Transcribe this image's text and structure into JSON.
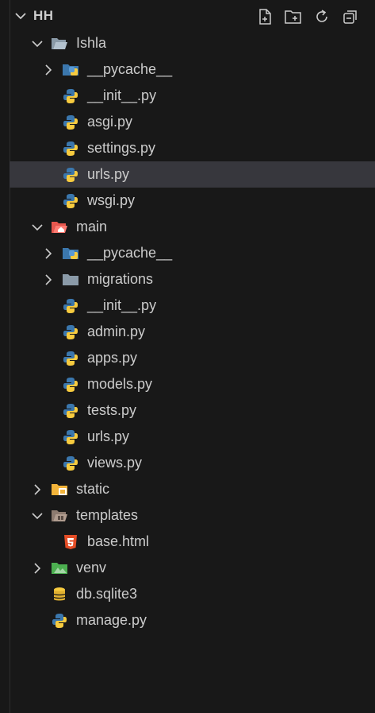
{
  "explorer": {
    "root": "HH",
    "actions": [
      "new-file",
      "new-folder",
      "refresh",
      "collapse-all"
    ]
  },
  "tree": {
    "ishla": {
      "label": "Ishla",
      "children": [
        "__pycache__",
        "__init__.py",
        "asgi.py",
        "settings.py",
        "urls.py",
        "wsgi.py"
      ]
    },
    "main": {
      "label": "main",
      "children": [
        "__pycache__",
        "migrations",
        "__init__.py",
        "admin.py",
        "apps.py",
        "models.py",
        "tests.py",
        "urls.py",
        "views.py"
      ]
    },
    "static": {
      "label": "static"
    },
    "templates": {
      "label": "templates",
      "children": [
        "base.html"
      ]
    },
    "venv": {
      "label": "venv"
    },
    "files": [
      "db.sqlite3",
      "manage.py"
    ]
  },
  "colors": {
    "background": "#181818",
    "selection": "#37373d",
    "python_blue": "#3b77ad",
    "python_yellow": "#f7cb3f",
    "html_orange": "#e44d26",
    "folder_gray": "#8a9aa8",
    "main_red": "#e8574e",
    "static_yellow": "#f3b43a",
    "venv_green": "#4caf50"
  }
}
